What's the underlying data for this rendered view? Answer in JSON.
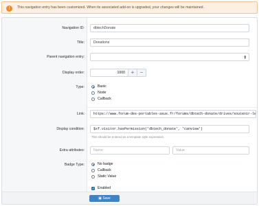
{
  "notice": {
    "text": "This navigation entry has been customized. When its associated add-on is upgraded, your changes will be maintained."
  },
  "form": {
    "navigation_id": {
      "label": "Navigation ID:",
      "value": "dbtechDonate"
    },
    "title": {
      "label": "Title:",
      "value": "Donations"
    },
    "parent": {
      "label": "Parent navigation entry:",
      "value": ""
    },
    "display_order": {
      "label": "Display order:",
      "value": "1000",
      "plus": "+",
      "minus": "−"
    },
    "type": {
      "label": "Type:",
      "options": [
        {
          "label": "Basic",
          "selected": true
        },
        {
          "label": "Node",
          "selected": false
        },
        {
          "label": "Callback",
          "selected": false
        }
      ]
    },
    "link": {
      "label": "Link:",
      "value": "https://www.forum-des-portables-asus.fr/forums/dbtech-donate/drives/soutenir-les-forum"
    },
    "display_condition": {
      "label": "Display condition:",
      "value": "$xf.visitor.hasPermission('dbtech_donate', 'canview')",
      "hint": "This should be entered as a template style expression."
    },
    "extra_attributes": {
      "label": "Extra attributes:",
      "name_placeholder": "Name",
      "value_placeholder": "Value"
    },
    "badge_type": {
      "label": "Badge Type:",
      "options": [
        {
          "label": "No badge",
          "selected": true
        },
        {
          "label": "Callback",
          "selected": false
        },
        {
          "label": "Static Value",
          "selected": false
        }
      ]
    },
    "enabled": {
      "label": "Enabled",
      "checked": true
    }
  },
  "footer": {
    "save_label": "Save",
    "save_icon": "floppy-disk-icon"
  },
  "colors": {
    "accent": "#2577b1",
    "notice_bg": "#fdf0e2",
    "notice_border": "#efc290",
    "warn": "#ef8a2a"
  }
}
